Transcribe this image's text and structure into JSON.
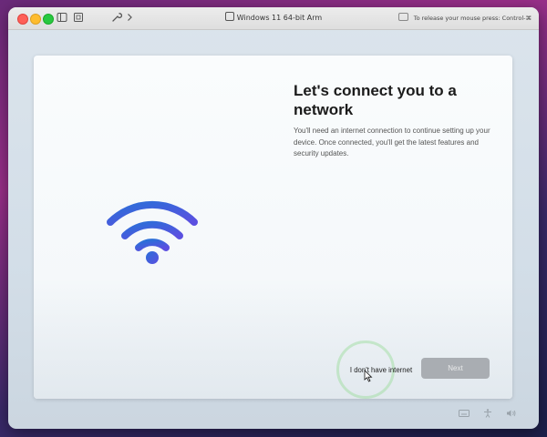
{
  "window": {
    "title": "Windows 11 64-bit Arm",
    "release_hint": "To release your mouse press: Control-⌘"
  },
  "titlebar_icons": [
    "sidebar-icon",
    "snapshot-icon",
    "wrench-icon",
    "chevron-right-icon"
  ],
  "setup": {
    "heading": "Let's connect you to a network",
    "description": "You'll need an internet connection to continue setting up your device. Once connected, you'll get the latest features and security updates.",
    "no_internet_label": "I don't have internet",
    "next_label": "Next"
  },
  "colors": {
    "wifi_gradient_start": "#2b6fd8",
    "wifi_gradient_end": "#5b4fe0",
    "next_button": "#a9adb2"
  },
  "status_icons": [
    "keyboard-icon",
    "accessibility-icon",
    "volume-icon"
  ]
}
